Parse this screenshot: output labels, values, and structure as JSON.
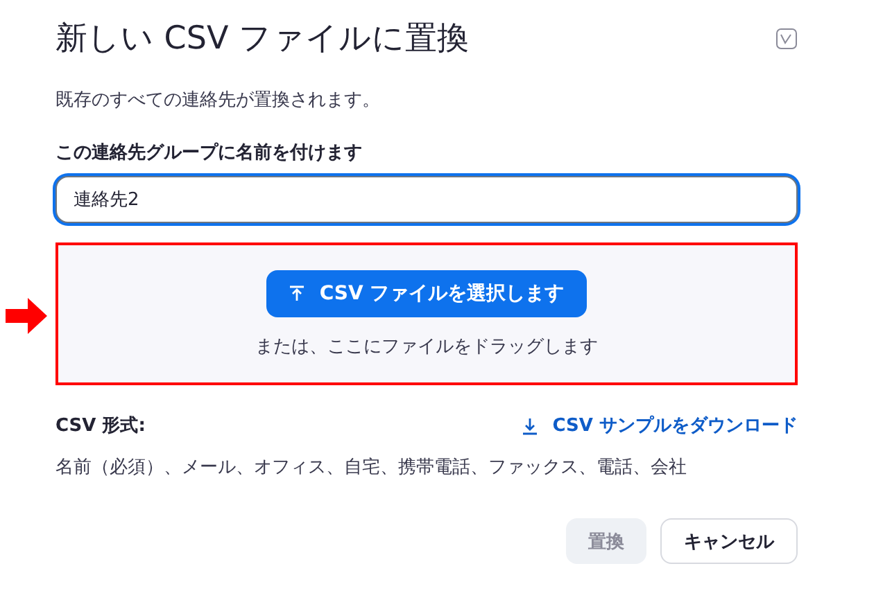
{
  "dialog": {
    "title": "新しい CSV ファイルに置換",
    "description": "既存のすべての連絡先が置換されます。"
  },
  "name_field": {
    "label": "この連絡先グループに名前を付けます",
    "value": "連絡先2",
    "focused": true
  },
  "dropzone": {
    "button": "CSV ファイルを選択します",
    "hint": "または、ここにファイルをドラッグします",
    "highlighted": true
  },
  "format": {
    "label": "CSV 形式:",
    "link": "CSV サンプルをダウンロード",
    "fields": "名前（必須）、メール、オフィス、自宅、携帯電話、ファックス、電話、会社"
  },
  "buttons": [
    {
      "label": "置換",
      "kind": "primary",
      "disabled": true
    },
    {
      "label": "キャンセル",
      "kind": "secondary",
      "disabled": false
    }
  ]
}
